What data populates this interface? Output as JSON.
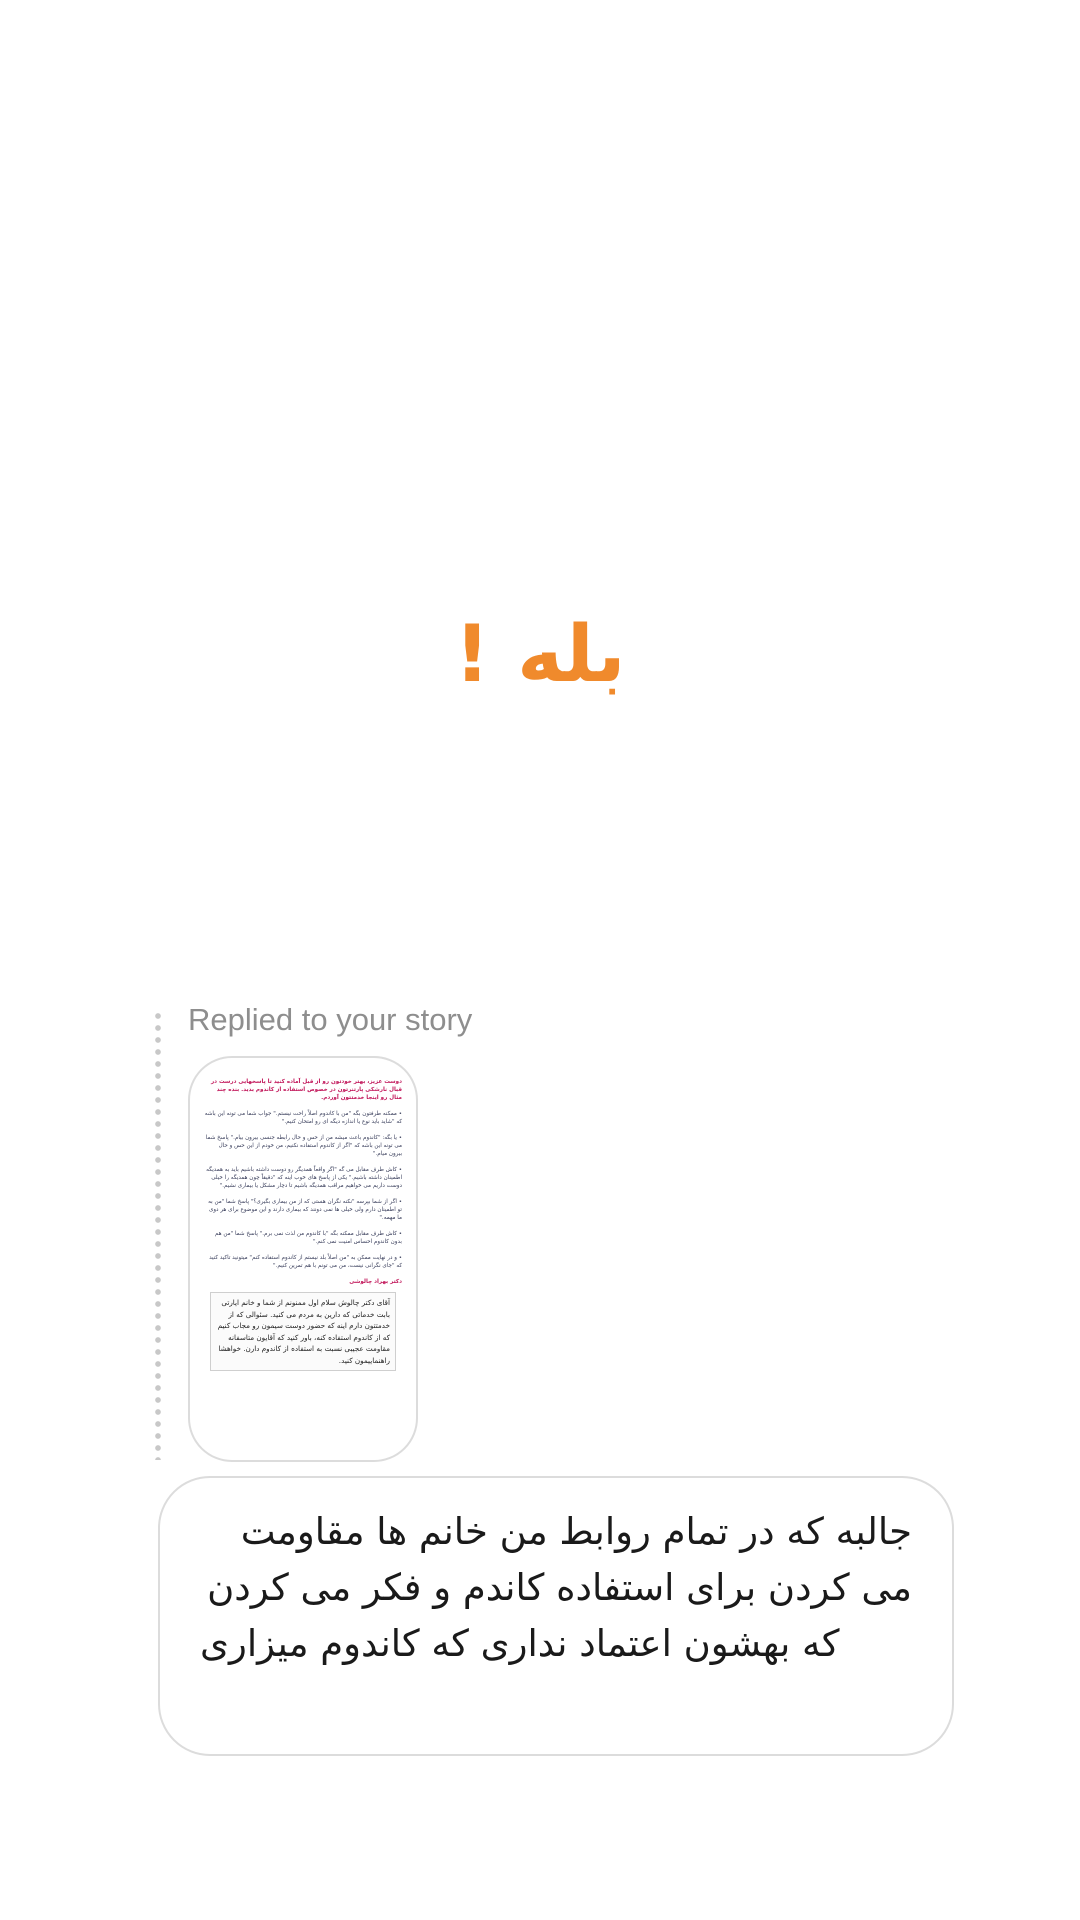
{
  "colors": {
    "accent_orange": "#f08a2c",
    "label_gray": "#8e8e8e",
    "border_gray": "#dcdcdc",
    "story_heading": "#c2185b"
  },
  "headline": "بله !",
  "reply": {
    "label": "Replied to your story"
  },
  "story": {
    "heading": "دوست عزیز، بهتر خودتون رو از قبل آماده کنید تا پاسخهایی درست در قبال نارشکی پارتنرتون در خصوص استفاده از کاندوم بدید. بنده چند مثال رو اینجا خدمتتون آوردم.",
    "paragraphs": [
      "• ممکنه طرفتون بگه \"من با کاندوم اصلاً راحت نیستم.\" جواب شما می تونه این باشه که \"شاید باید نوع یا اندازه دیگه ای رو امتحان کنیم.\"",
      "• یا بگه: \"کاندوم باعث میشه من از حس و حال رابطه جنسی بیرون بیام.\" پاسخ شما می تونه این باشه که \"اگر از کاندوم استفاده نکنیم، من خودم از این حس و حال بیرون میام.\"",
      "• کاش طرف مقابل می گه \"اگر واقعاً همدیگر رو دوست داشته باشیم باید به همدیگه اطمینان داشته باشیم.\" یکی از پاسخ های خوب اینه که \"دقیقاً چون همدیگه را خیلی دوست داریم می خواهیم مراقب همدیگه باشیم تا دچار مشکل یا بیماری نشیم.\"",
      "• اگر از شما بپرسه \"نکنه نگران هستی که از من بیماری بگیری؟\" پاسخ شما \"من به تو اطمینان دارم ولی خیلی ها نمی دونند که بیماری دارند و این موضوع برای هر دوی ما مهمه.\"",
      "• کاش طرف مقابل ممکنه بگه \"با کاندوم من لذت نمی برم.\" پاسخ شما \"من هم بدون کاندوم احساس امنیت نمی کنم.\"",
      "• و در نهایت ممکن به \"من اصلاً بلد نیستم از کاندوم استفاده کنم\" میتونید تاکید کنید که \"جای نگرانی نیست، من می تونم با هم تمرین کنیم.\""
    ],
    "signature": "دکتر بهراد چالوشی",
    "note": "آقای دکتر چالوش سلام اول ممنونم از شما و خانم ایارتی بابت خدماتی که دارین به مردم می کنید. سئوالی که از خدمتتون دارم اینه که حضور دوست سیمون رو مجاب کنیم که از کاندوم استفاده کنه، باور کنید که آقایون متاسفانه مقاومت عجیبی نسبت به استفاده از کاندوم دارن. خواهشا راهنماییمون کنید."
  },
  "message": {
    "text": "جالبه که در تمام روابط من خانم ها مقاومت می کردن برای استفاده کاندم و فکر می کردن که بهشون اعتماد نداری که کاندوم میزاری"
  }
}
